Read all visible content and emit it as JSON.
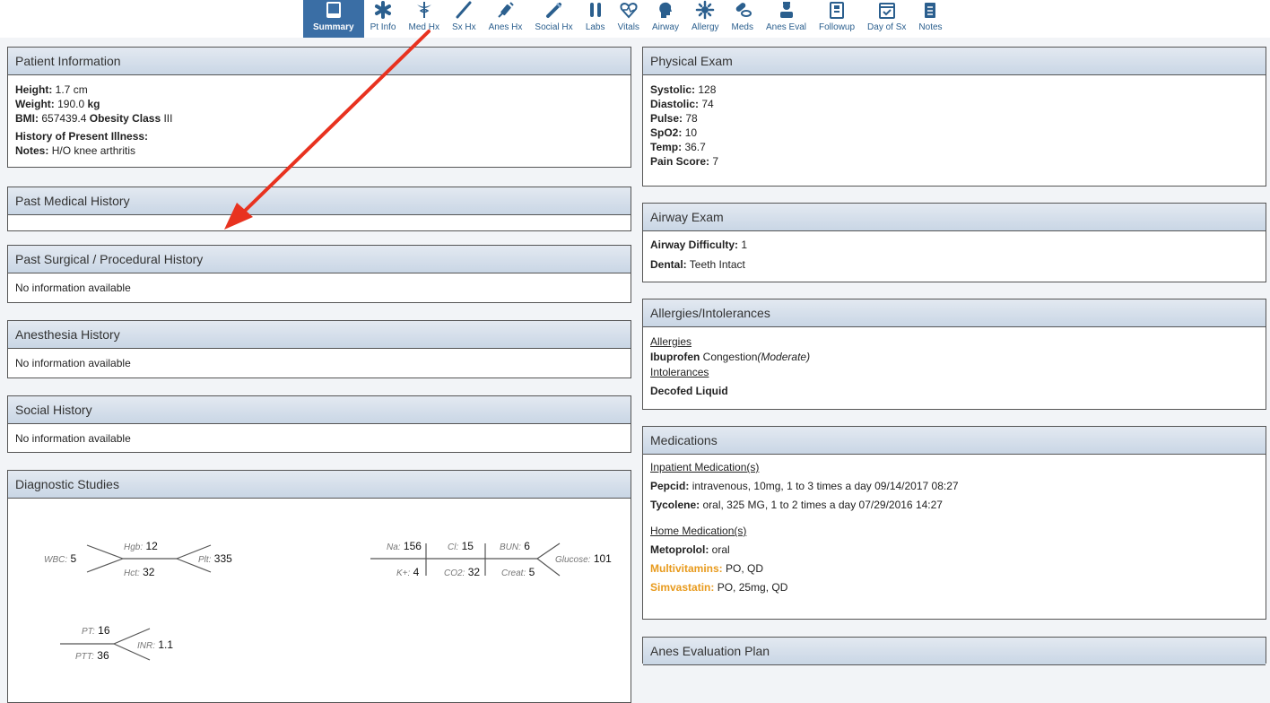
{
  "nav": {
    "items": [
      {
        "label": "Summary",
        "icon": "document-icon"
      },
      {
        "label": "Pt Info",
        "icon": "asterisk-icon"
      },
      {
        "label": "Med Hx",
        "icon": "caduceus-icon"
      },
      {
        "label": "Sx Hx",
        "icon": "scalpel-icon"
      },
      {
        "label": "Anes Hx",
        "icon": "syringe-icon"
      },
      {
        "label": "Social Hx",
        "icon": "cigarette-icon"
      },
      {
        "label": "Labs",
        "icon": "test-tubes-icon"
      },
      {
        "label": "Vitals",
        "icon": "heart-pulse-icon"
      },
      {
        "label": "Airway",
        "icon": "head-profile-icon"
      },
      {
        "label": "Allergy",
        "icon": "allergy-icon"
      },
      {
        "label": "Meds",
        "icon": "pills-icon"
      },
      {
        "label": "Anes Eval",
        "icon": "doctor-icon"
      },
      {
        "label": "Followup",
        "icon": "clipboard-icon"
      },
      {
        "label": "Day of Sx",
        "icon": "calendar-check-icon"
      },
      {
        "label": "Notes",
        "icon": "notes-icon"
      }
    ]
  },
  "patient_info": {
    "title": "Patient Information",
    "height_label": "Height:",
    "height_value": "1.7 cm",
    "weight_label": "Weight:",
    "weight_value": "190.0",
    "weight_unit": "kg",
    "bmi_label": "BMI:",
    "bmi_value": "657439.4",
    "bmi_class_label": "Obesity Class",
    "bmi_class_value": "III",
    "hpi_label": "History of Present",
    "hpi_label2": "Illness:",
    "notes_label": "Notes:",
    "notes_value": "H/O knee arthritis"
  },
  "past_medical": {
    "title": "Past Medical History"
  },
  "past_surgical": {
    "title": "Past Surgical / Procedural History",
    "empty": "No information available"
  },
  "anesthesia": {
    "title": "Anesthesia History",
    "empty": "No information available"
  },
  "social": {
    "title": "Social History",
    "empty": "No information available"
  },
  "diagnostics": {
    "title": "Diagnostic Studies",
    "cbc": {
      "wbc_k": "WBC:",
      "wbc_v": "5",
      "hgb_k": "Hgb:",
      "hgb_v": "12",
      "plt_k": "Plt:",
      "plt_v": "335",
      "hct_k": "Hct:",
      "hct_v": "32"
    },
    "bmp": {
      "na_k": "Na:",
      "na_v": "156",
      "cl_k": "Cl:",
      "cl_v": "15",
      "bun_k": "BUN:",
      "bun_v": "6",
      "k_k": "K+:",
      "k_v": "4",
      "co2_k": "CO2:",
      "co2_v": "32",
      "creat_k": "Creat:",
      "creat_v": "5",
      "glu_k": "Glucose:",
      "glu_v": "101"
    },
    "coag": {
      "pt_k": "PT:",
      "pt_v": "16",
      "inr_k": "INR:",
      "inr_v": "1.1",
      "ptt_k": "PTT:",
      "ptt_v": "36"
    }
  },
  "physical": {
    "title": "Physical Exam",
    "systolic_label": "Systolic:",
    "systolic_value": "128",
    "diastolic_label": "Diastolic:",
    "diastolic_value": "74",
    "pulse_label": "Pulse:",
    "pulse_value": "78",
    "spo2_label": "SpO2:",
    "spo2_value": "10",
    "temp_label": "Temp:",
    "temp_value": "36.7",
    "pain_label": "Pain Score:",
    "pain_value": "7"
  },
  "airway": {
    "title": "Airway Exam",
    "difficulty_label": "Airway Difficulty:",
    "difficulty_value": "1",
    "dental_label": "Dental:",
    "dental_value": "Teeth Intact"
  },
  "allergies": {
    "title": "Allergies/Intolerances",
    "allergies_heading": "Allergies",
    "allergy1_name": "Ibuprofen",
    "allergy1_reaction": "Congestion",
    "allergy1_severity": "(Moderate)",
    "intolerances_heading": "Intolerances",
    "intolerance1": "Decofed Liquid"
  },
  "medications": {
    "title": "Medications",
    "inpatient_heading": "Inpatient Medication(s)",
    "inpatient": [
      {
        "name": "Pepcid:",
        "detail": "intravenous, 10mg, 1 to 3 times a day 09/14/2017 08:27"
      },
      {
        "name": "Tycolene:",
        "detail": "oral, 325 MG, 1 to 2 times a day 07/29/2016 14:27"
      }
    ],
    "home_heading": "Home Medication(s)",
    "home": [
      {
        "name": "Metoprolol:",
        "detail": "oral",
        "highlight": false
      },
      {
        "name": "Multivitamins:",
        "detail": "PO, QD",
        "highlight": true
      },
      {
        "name": "Simvastatin:",
        "detail": "PO, 25mg, QD",
        "highlight": true
      }
    ],
    "highlight_color": "#e89a1c"
  },
  "anes_eval": {
    "title": "Anes Evaluation Plan"
  },
  "colors": {
    "header_accent": "#3a6ea5",
    "arrow": "#e8321f"
  }
}
